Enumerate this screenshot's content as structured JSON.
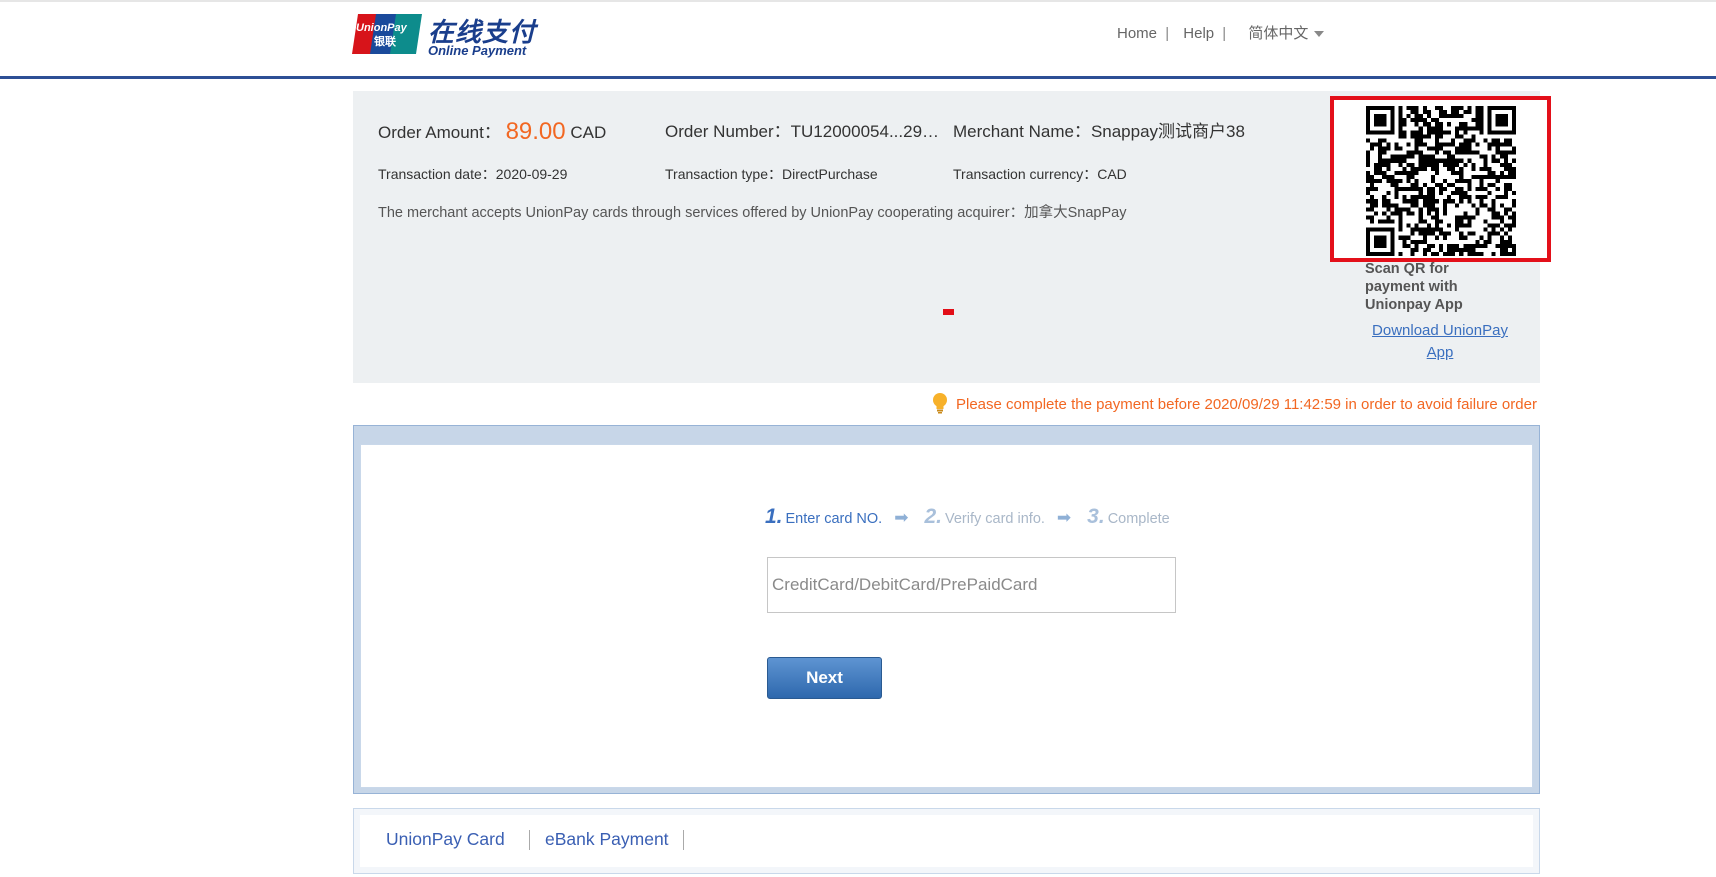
{
  "header": {
    "logo_card_text_1": "UnionPay",
    "logo_card_text_2": "银联",
    "logo_cn": "在线支付",
    "logo_en": "Online Payment",
    "nav": {
      "home": "Home",
      "help": "Help",
      "separator": "|",
      "language": "简体中文"
    }
  },
  "order": {
    "amount_label": "Order Amount：",
    "amount_value": "89.00",
    "amount_currency": "CAD",
    "number_label": "Order Number：",
    "number_value": "TU12000054...29…",
    "merchant_label": "Merchant Name：",
    "merchant_value": "Snappay测试商户38",
    "date_label": "Transaction date：",
    "date_value": "2020-09-29",
    "type_label": "Transaction type：",
    "type_value": "DirectPurchase",
    "currency_label": "Transaction currency：",
    "currency_value": "CAD",
    "acquirer_note": "The merchant accepts UnionPay cards through services offered by UnionPay cooperating acquirer：加拿大SnapPay"
  },
  "qr": {
    "scan_text": "Scan QR for payment with Unionpay App",
    "download_link": "Download UnionPay App"
  },
  "warning": "Please complete the payment before 2020/09/29 11:42:59 in order to avoid failure order",
  "steps": [
    {
      "num": "1.",
      "label": "Enter card NO."
    },
    {
      "num": "2.",
      "label": "Verify card info."
    },
    {
      "num": "3.",
      "label": "Complete"
    }
  ],
  "card_input": {
    "value": "",
    "placeholder": "CreditCard/DebitCard/PrePaidCard"
  },
  "next_button": "Next",
  "tabs": [
    {
      "label": "UnionPay Card"
    },
    {
      "label": "eBank Payment"
    }
  ],
  "colors": {
    "brand_blue": "#2d4f95",
    "amount_orange": "#f26722",
    "highlight_red": "#e3101a",
    "link_blue": "#3a6fbf"
  }
}
